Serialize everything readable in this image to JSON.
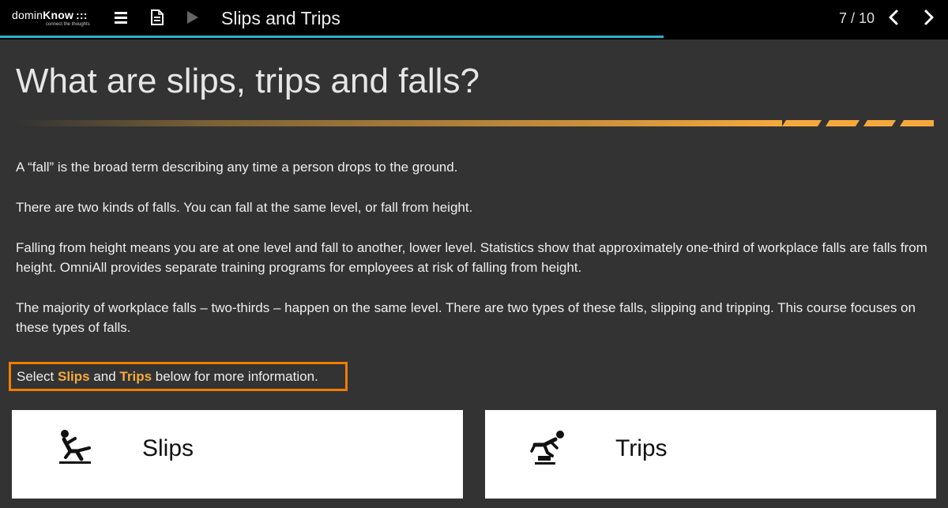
{
  "topbar": {
    "logo_word_light": "domin",
    "logo_word_bold": "Know",
    "logo_dots": ":::",
    "logo_tagline": "connect the thoughts",
    "title": "Slips and Trips",
    "page_counter": "7 / 10",
    "progress_fraction": 0.7,
    "progress_color": "#2bb3c9",
    "icons": [
      "menu-icon",
      "document-icon",
      "play-icon",
      "previous-icon",
      "next-icon"
    ]
  },
  "content": {
    "heading": "What are slips, trips and falls?",
    "paragraphs": [
      "A “fall” is the broad term describing any time a person drops to the ground.",
      "There are two kinds of falls. You can fall at the same level, or fall from height.",
      "Falling from height means you are at one level and fall to another, lower level. Statistics show that approximately one-third of workplace falls are falls from height. OmniAll provides separate training programs for employees at risk of falling from height.",
      "The majority of workplace falls – two-thirds – happen on the same level. There are two types of these falls, slipping and tripping. This course focuses on these types of falls."
    ],
    "callout": {
      "part1": "Select ",
      "slips": "Slips",
      "part2": " and ",
      "trips": "Trips",
      "part3": " below for more information."
    },
    "accent_color": "#f5a93d",
    "callout_border_color": "#f07d00"
  },
  "cards": [
    {
      "label": "Slips",
      "icon": "slip-fall-icon"
    },
    {
      "label": "Trips",
      "icon": "trip-fall-icon"
    }
  ]
}
